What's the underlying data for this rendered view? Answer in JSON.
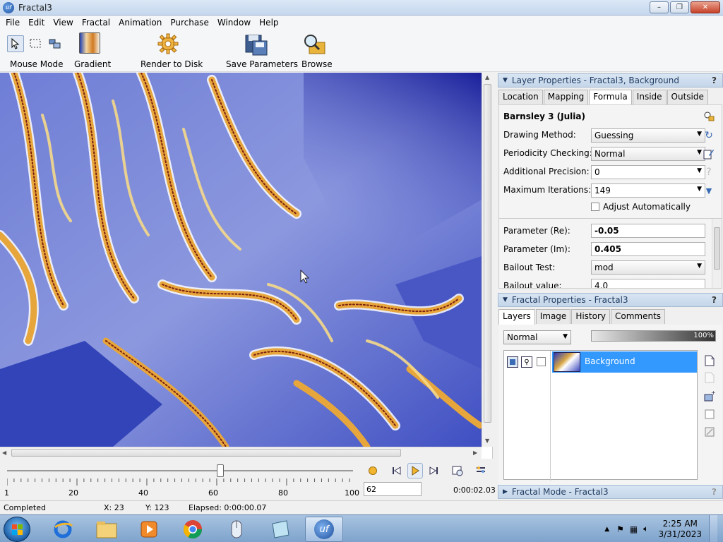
{
  "window": {
    "title": "Fractal3",
    "icon_text": "uf",
    "minimize": "–",
    "maximize": "❐",
    "close": "✕"
  },
  "menu": [
    "File",
    "Edit",
    "View",
    "Fractal",
    "Animation",
    "Purchase",
    "Window",
    "Help"
  ],
  "toolbar": {
    "mouse_mode": "Mouse Mode",
    "gradient": "Gradient",
    "render_to_disk": "Render to Disk",
    "save_parameters": "Save Parameters",
    "browse": "Browse"
  },
  "timeline": {
    "tick_labels": [
      "1",
      "20",
      "40",
      "60",
      "80",
      "100"
    ],
    "frame": "62",
    "time": "0:00:02.03",
    "slider_position_frame": 62
  },
  "status": {
    "state": "Completed",
    "x": "X: 23",
    "y": "Y: 123",
    "elapsed": "Elapsed: 0:00:00.07"
  },
  "layer_properties": {
    "header": "Layer Properties - Fractal3, Background",
    "tabs": [
      "Location",
      "Mapping",
      "Formula",
      "Inside",
      "Outside"
    ],
    "active_tab": "Formula",
    "formula_name": "Barnsley 3 (Julia)",
    "rows": {
      "drawing_method_label": "Drawing Method:",
      "drawing_method_value": "Guessing",
      "periodicity_label": "Periodicity Checking:",
      "periodicity_value": "Normal",
      "precision_label": "Additional Precision:",
      "precision_value": "0",
      "max_iter_label": "Maximum Iterations:",
      "max_iter_value": "149",
      "adjust_auto_label": "Adjust Automatically",
      "param_re_label": "Parameter (Re):",
      "param_re_value": "-0.05",
      "param_im_label": "Parameter (Im):",
      "param_im_value": "0.405",
      "bailout_test_label": "Bailout Test:",
      "bailout_test_value": "mod",
      "bailout_value_label": "Bailout value:",
      "bailout_value_value": "4.0"
    }
  },
  "fractal_properties": {
    "header": "Fractal Properties - Fractal3",
    "tabs": [
      "Layers",
      "Image",
      "History",
      "Comments"
    ],
    "active_tab": "Layers",
    "blend_mode": "Normal",
    "opacity": "100%",
    "layers": [
      {
        "name": "Background"
      }
    ]
  },
  "fractal_mode": {
    "header": "Fractal Mode - Fractal3"
  },
  "help_mark": "?",
  "taskbar": {
    "clock_time": "2:25 AM",
    "clock_date": "3/31/2023"
  },
  "colors": {
    "fractal_blue": "#2a38b5",
    "fractal_gold": "#e6a63c",
    "selection": "#3399ff",
    "panel_header": "#c4d6ea"
  }
}
